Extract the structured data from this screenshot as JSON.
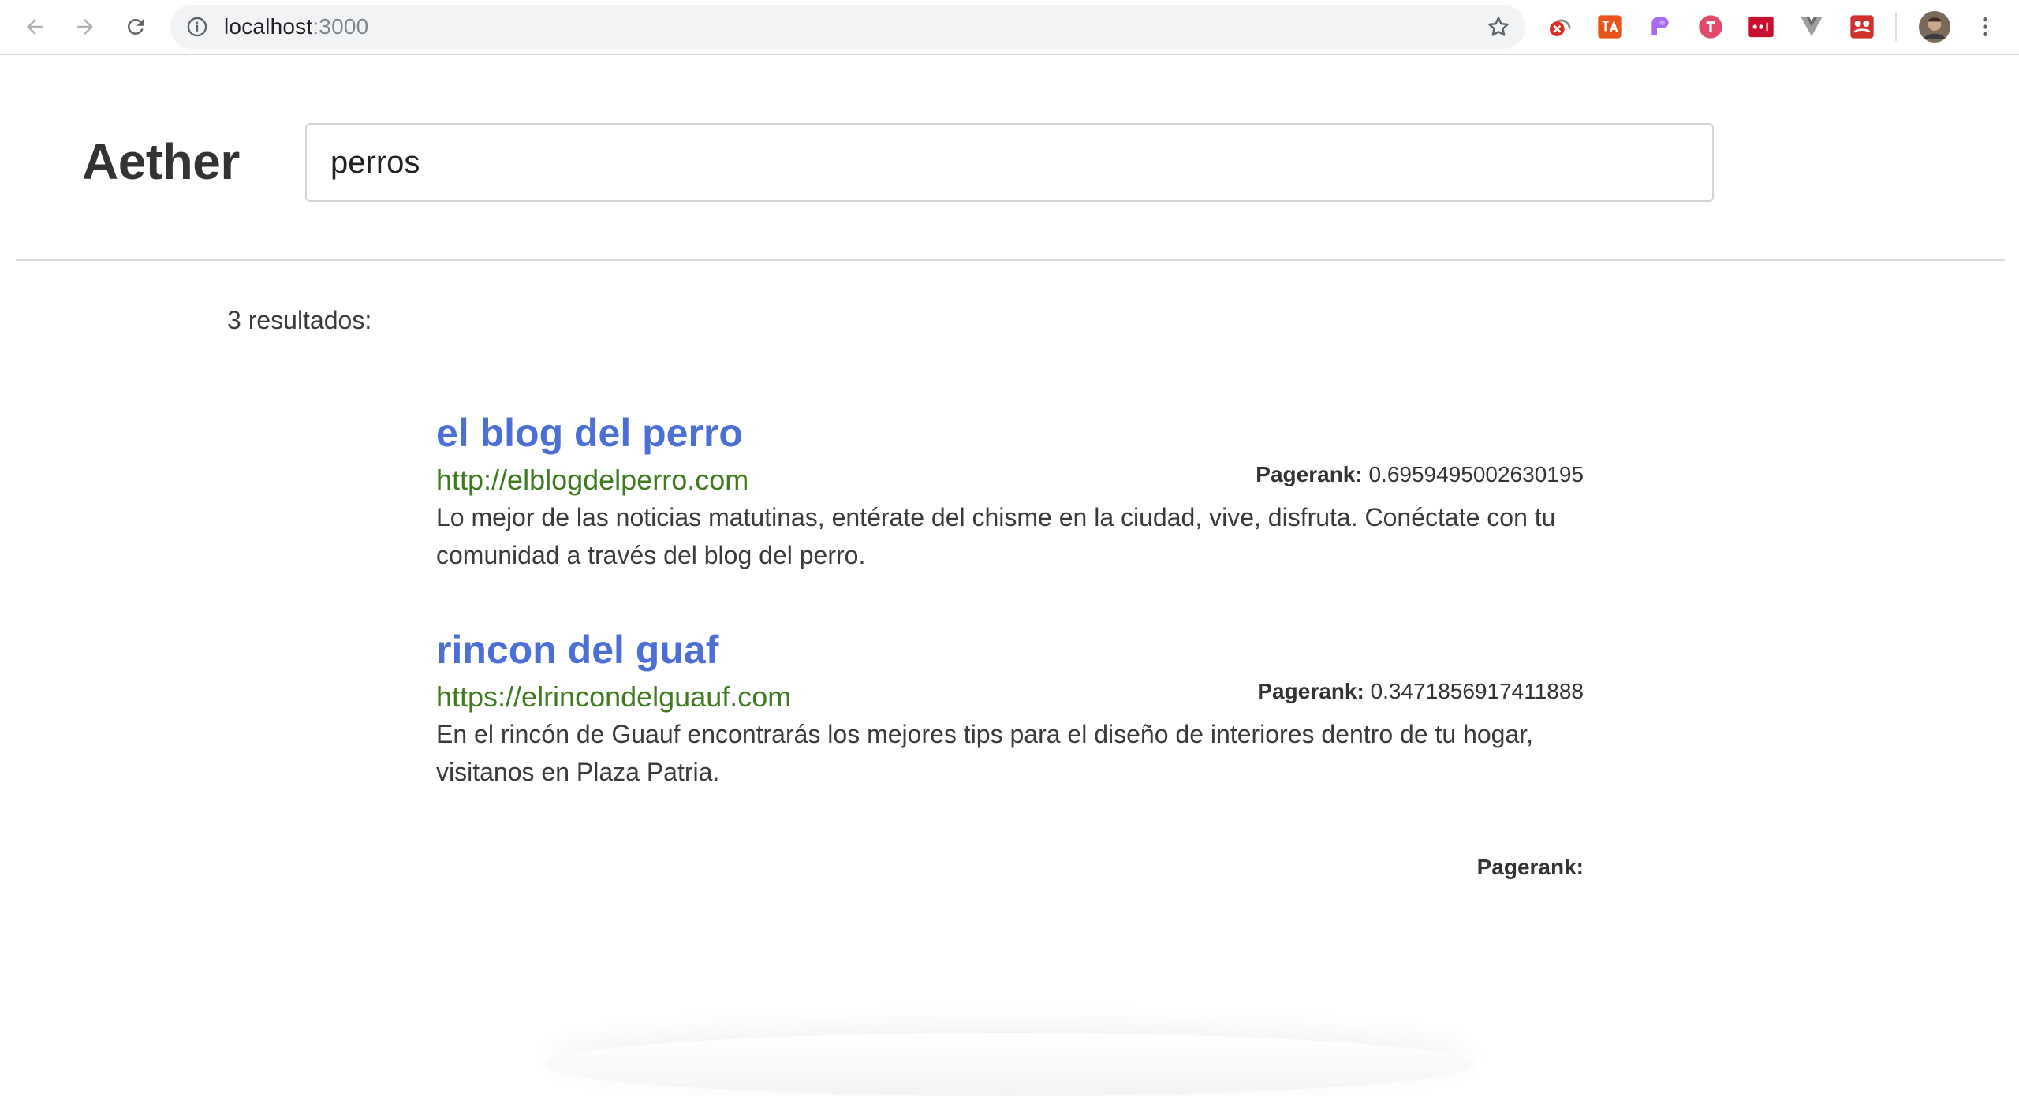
{
  "browser": {
    "url_host": "localhost",
    "url_port": ":3000",
    "extensions": [
      "adblock-icon",
      "translate-icon",
      "tab-icon",
      "toggl-icon",
      "lastpass-icon",
      "vue-devtools-icon",
      "screenshot-icon"
    ]
  },
  "header": {
    "brand": "Aether",
    "search_value": "perros"
  },
  "results": {
    "count_text": "3 resultados:",
    "pagerank_label": "Pagerank:",
    "items": [
      {
        "title": "el blog del perro",
        "url": "http://elblogdelperro.com",
        "pagerank": "0.6959495002630195",
        "description": "Lo mejor de las noticias matutinas, entérate del chisme en la ciudad, vive, disfruta. Conéctate con tu comunidad a través del blog del perro."
      },
      {
        "title": "rincon del guaf",
        "url": "https://elrincondelguauf.com",
        "pagerank": "0.3471856917411888",
        "description": "En el rincón de Guauf encontrarás los mejores tips para el diseño de interiores dentro de tu hogar, visitanos en Plaza Patria."
      },
      {
        "title": "",
        "url": "",
        "pagerank": "",
        "description": ""
      }
    ]
  },
  "colors": {
    "title": "#4c6fd6",
    "url": "#3f7a1e",
    "text": "#333333"
  }
}
